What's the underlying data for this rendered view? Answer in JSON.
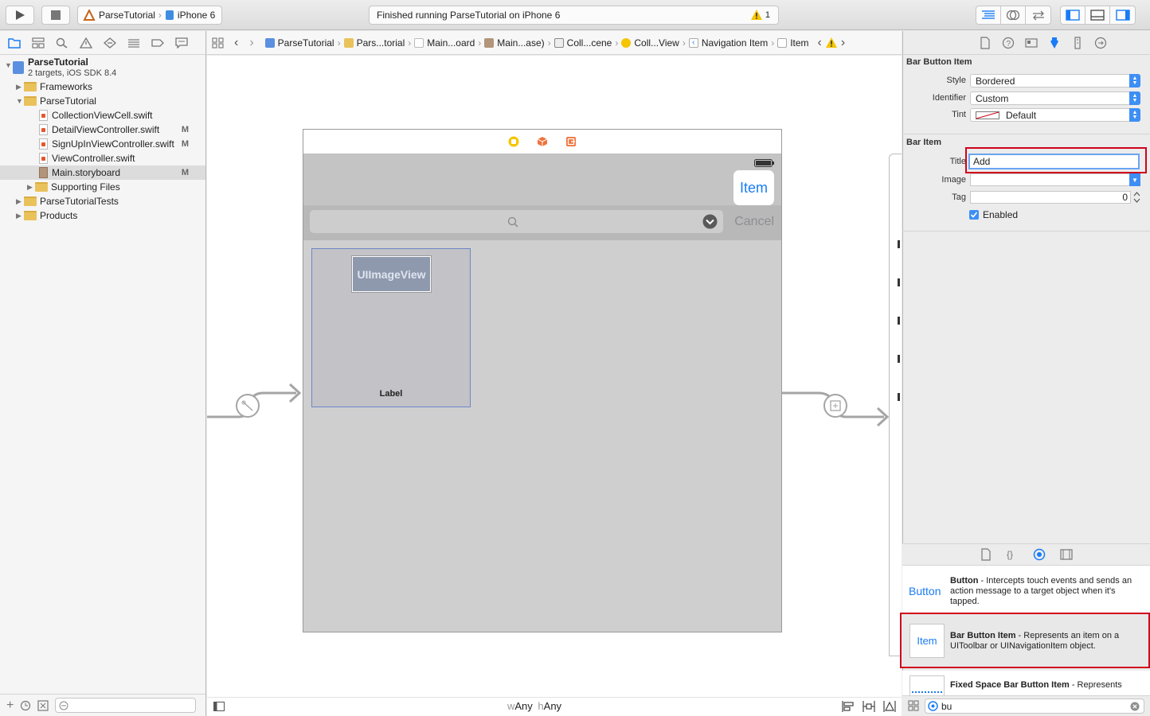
{
  "toolbar": {
    "scheme_target": "ParseTutorial",
    "scheme_device": "iPhone 6",
    "activity_text": "Finished running ParseTutorial on iPhone 6",
    "warning_count": "1"
  },
  "navigator": {
    "project_name": "ParseTutorial",
    "project_subtitle": "2 targets, iOS SDK 8.4",
    "items": [
      {
        "label": "Frameworks",
        "badge": ""
      },
      {
        "label": "ParseTutorial",
        "badge": ""
      },
      {
        "label": "CollectionViewCell.swift",
        "badge": ""
      },
      {
        "label": "DetailViewController.swift",
        "badge": "M"
      },
      {
        "label": "SignUpInViewController.swift",
        "badge": "M"
      },
      {
        "label": "ViewController.swift",
        "badge": ""
      },
      {
        "label": "Main.storyboard",
        "badge": "M"
      },
      {
        "label": "Supporting Files",
        "badge": ""
      },
      {
        "label": "ParseTutorialTests",
        "badge": ""
      },
      {
        "label": "Products",
        "badge": ""
      }
    ]
  },
  "jumpbar": {
    "crumbs": [
      "ParseTutorial",
      "Pars...torial",
      "Main...oard",
      "Main...ase)",
      "Coll...cene",
      "Coll...View",
      "Navigation Item",
      "Item"
    ]
  },
  "canvas": {
    "nav_button": "Item",
    "search_cancel": "Cancel",
    "image_view": "UIImageView",
    "cell_label": "Label",
    "size_class_w_prefix": "w",
    "size_class_w": "Any",
    "size_class_h_prefix": "h",
    "size_class_h": "Any"
  },
  "inspector": {
    "bar_button_item_title": "Bar Button Item",
    "style_label": "Style",
    "style_value": "Bordered",
    "identifier_label": "Identifier",
    "identifier_value": "Custom",
    "tint_label": "Tint",
    "tint_value": "Default",
    "bar_item_title": "Bar Item",
    "title_label": "Title",
    "title_value": "Add",
    "image_label": "Image",
    "image_value": "",
    "tag_label": "Tag",
    "tag_value": "0",
    "enabled_label": "Enabled",
    "enabled": true
  },
  "library": {
    "items": [
      {
        "icon_text": "Button",
        "name": "Button",
        "desc": " - Intercepts touch events and sends an action message to a target object when it's tapped."
      },
      {
        "icon_text": "Item",
        "name": "Bar Button Item",
        "desc": " - Represents an item on a UIToolbar or UINavigationItem object."
      },
      {
        "icon_text": "",
        "name": "Fixed Space Bar Button Item",
        "desc": " - Represents"
      }
    ],
    "filter_value": "bu"
  },
  "colors": {
    "accent": "#1a7cf5",
    "highlight": "#d0021b",
    "warning": "#f5c500"
  }
}
